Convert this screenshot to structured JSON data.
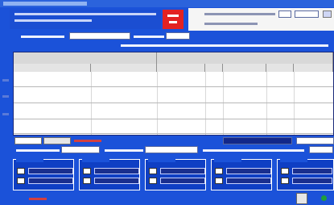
{
  "colors": {
    "window_blue": "#1b52d9",
    "dark_field": "#12278a",
    "red_badge": "#e32222",
    "grid_white": "#ffffff",
    "status_green": "#1f9e3a"
  },
  "icons": [
    "checkbox-icon",
    "dropdown-chevron-icon",
    "settings-icon",
    "go-icon"
  ],
  "grid": {
    "rows": 5
  }
}
